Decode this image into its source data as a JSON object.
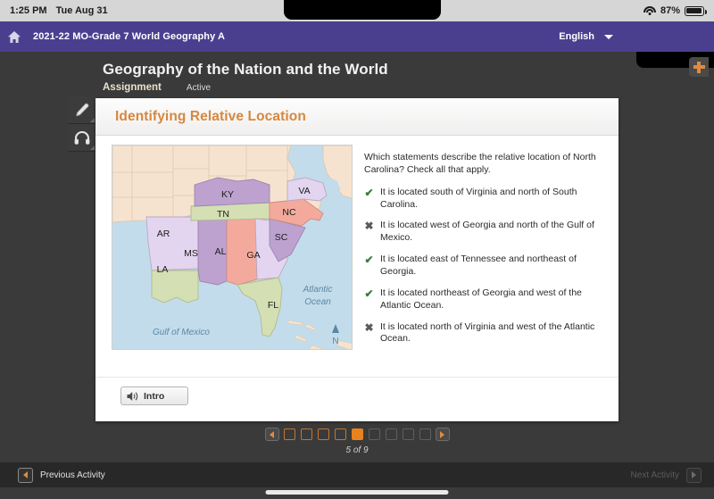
{
  "status_bar": {
    "time": "1:25 PM",
    "date": "Tue Aug 31",
    "battery_percent": "87%",
    "wifi_icon": "wifi-icon",
    "battery_icon": "battery-icon"
  },
  "app_header": {
    "home_icon": "home-icon",
    "course_title": "2021-22 MO-Grade 7 World Geography A",
    "language": "English",
    "language_chevron_icon": "chevron-down-icon",
    "brand_color": "#4a3f8f"
  },
  "page": {
    "title": "Geography of the Nation and the World",
    "type_label": "Assignment",
    "status_label": "Active",
    "add_icon": "plus-icon"
  },
  "tool_rail": {
    "items": [
      {
        "name": "highlighter-tool",
        "icon": "pencil-icon"
      },
      {
        "name": "audio-tool",
        "icon": "headphones-icon"
      }
    ]
  },
  "lesson": {
    "header_title": "Identifying Relative Location",
    "header_color": "#d5883f",
    "prompt": "Which statements describe the relative location of North Carolina? Check all that apply.",
    "answers": [
      {
        "mark": "check",
        "glyph": "✔",
        "text": "It is located south of Virginia and north of South Carolina."
      },
      {
        "mark": "x",
        "glyph": "✖",
        "text": "It is located west of Georgia and north of the Gulf of Mexico."
      },
      {
        "mark": "check",
        "glyph": "✔",
        "text": "It is located east of Tennessee and northeast of Georgia."
      },
      {
        "mark": "check",
        "glyph": "✔",
        "text": "It is located northeast of Georgia and west of the Atlantic Ocean."
      },
      {
        "mark": "x",
        "glyph": "✖",
        "text": "It is located north of Virginia and west of the Atlantic Ocean."
      }
    ],
    "audio_button_label": "Intro",
    "audio_icon": "speaker-icon"
  },
  "map": {
    "state_labels": [
      "KY",
      "VA",
      "TN",
      "NC",
      "SC",
      "AR",
      "MS",
      "AL",
      "GA",
      "LA",
      "FL"
    ],
    "water_labels": [
      "Atlantic Ocean",
      "Gulf of Mexico"
    ],
    "atlantic_line1": "Atlantic",
    "atlantic_line2": "Ocean",
    "gulf_label": "Gulf of Mexico",
    "compass_label": "N",
    "label_ky": "KY",
    "label_va": "VA",
    "label_tn": "TN",
    "label_nc": "NC",
    "label_sc": "SC",
    "label_ar": "AR",
    "label_ms": "MS",
    "label_al": "AL",
    "label_ga": "GA",
    "label_la": "LA",
    "label_fl": "FL",
    "colors": {
      "water": "#c3dceb",
      "land": "#f6e3cf",
      "purple": "#bda2cf",
      "lavender": "#e3d5ef",
      "green": "#d4dfb4",
      "salmon": "#f3aa9c"
    }
  },
  "pager": {
    "prev_icon": "triangle-left-icon",
    "next_icon": "triangle-right-icon",
    "count_label": "5 of 9",
    "total": 9,
    "current": 5,
    "boxes": [
      "done",
      "done",
      "done",
      "done",
      "cur",
      "todo",
      "todo",
      "todo",
      "todo"
    ]
  },
  "bottom_bar": {
    "previous_label": "Previous Activity",
    "previous_icon": "triangle-left-icon",
    "next_label": "Next Activity",
    "next_icon": "triangle-right-icon",
    "next_disabled": true
  }
}
